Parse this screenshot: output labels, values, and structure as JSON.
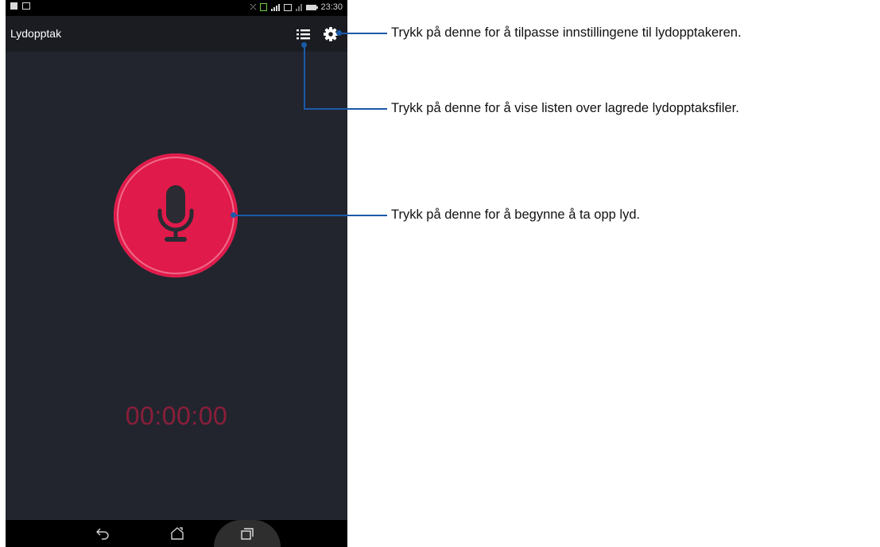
{
  "status_bar": {
    "time": "23:30",
    "icons": [
      "sd-card-icon",
      "screenshot-icon",
      "no-signal-icon",
      "sim1-icon",
      "signal-bars-icon",
      "sim2-icon",
      "sim2-signal-icon",
      "battery-icon"
    ]
  },
  "app_bar": {
    "title": "Lydopptak",
    "actions": [
      {
        "name": "recordings-list",
        "icon": "list-icon"
      },
      {
        "name": "settings",
        "icon": "gear-icon"
      }
    ]
  },
  "recorder": {
    "button_icon": "microphone-icon",
    "button_color": "#e01a4a",
    "timer": "00:00:00",
    "timer_color": "#8b1e3a"
  },
  "nav_bar": {
    "buttons": [
      "back-icon",
      "home-icon",
      "recent-apps-icon"
    ]
  },
  "callouts": [
    {
      "id": "settings",
      "text": "Trykk på denne for å tilpasse innstillingene til lydopptakeren."
    },
    {
      "id": "list",
      "text": "Trykk på denne for å vise listen over lagrede lydopptaksfiler."
    },
    {
      "id": "record",
      "text": "Trykk på denne for å begynne å ta opp lyd."
    }
  ],
  "colors": {
    "background": "#22252e",
    "accent": "#e01a4a",
    "callout_line": "#1a5aa8"
  }
}
